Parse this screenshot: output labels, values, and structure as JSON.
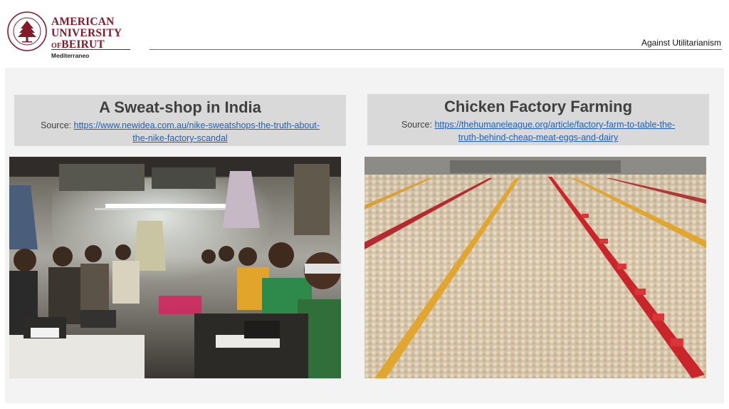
{
  "logo": {
    "line1": "AMERICAN",
    "line2": "UNIVERSITY",
    "line3_of": "OF",
    "line3": "BEIRUT",
    "subtitle": "Mediterraneo",
    "brand_color": "#84192a"
  },
  "header": {
    "title": "Against Utilitarianism"
  },
  "left": {
    "title": "A Sweat-shop in India",
    "source_label": "Source: ",
    "source_url": "https://www.newidea.com.au/nike-sweatshops-the-truth-about-the-nike-factory-scandal",
    "source_line1": "https://www.newidea.com.au/nike-sweatshops-the-truth-about-",
    "source_line2": "the-nike-factory-scandal"
  },
  "right": {
    "title": "Chicken Factory Farming",
    "source_label": "Source: ",
    "source_url": "https://thehumaneleague.org/article/factory-farm-to-table-the-truth-behind-cheap-meat-eggs-and-dairy",
    "source_line1": "https://thehumaneleague.org/article/factory-farm-to-table-the-",
    "source_line2": "truth-behind-cheap-meat-eggs-and-dairy"
  }
}
